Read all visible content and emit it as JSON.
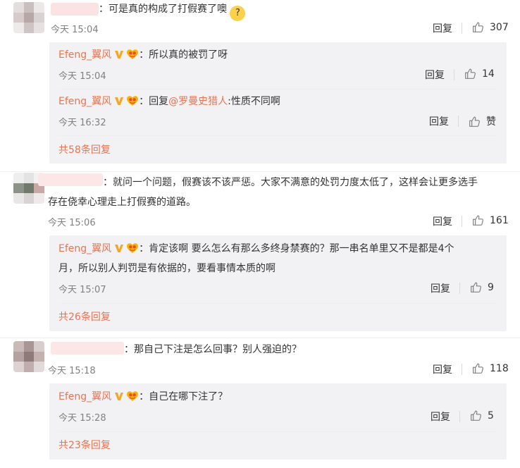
{
  "comments": [
    {
      "text": "：可是真的构成了打假赛了噢",
      "emoji": "🤔",
      "time": "今天 15:04",
      "reply_label": "回复",
      "likes": "307",
      "sub": [
        {
          "user": "Efeng_翼风",
          "text": "：所以真的被罚了呀",
          "time": "今天 15:04",
          "reply_label": "回复",
          "likes": "14"
        },
        {
          "user": "Efeng_翼风",
          "text_prefix": "：回复",
          "mention": "@罗曼史猎人",
          "text_suffix": ":性质不同啊",
          "time": "今天 16:32",
          "reply_label": "回复",
          "likes": "赞"
        }
      ],
      "more": "共58条回复"
    },
    {
      "text_line1": "：就问一个问题，假赛该不该严惩。大家不满意的处罚力度太低了，这样会让更多选手",
      "text_line2": "存在侥幸心理走上打假赛的道路。",
      "time": "今天 15:06",
      "reply_label": "回复",
      "likes": "161",
      "sub": [
        {
          "user": "Efeng_翼风",
          "text_line1": "：肯定该啊 要么怎么有那么多终身禁赛的？那一串名单里又不是都是4个",
          "text_line2": "月，所以别人判罚是有依据的，要看事情本质的啊",
          "time": "今天 15:07",
          "reply_label": "回复",
          "likes": "9"
        }
      ],
      "more": "共26条回复"
    },
    {
      "text": "：那自己下注是怎么回事？别人强迫的？",
      "time": "今天 15:18",
      "reply_label": "回复",
      "likes": "118",
      "sub": [
        {
          "user": "Efeng_翼风",
          "text": "：自己在哪下注了？",
          "time": "今天 15:28",
          "reply_label": "回复",
          "likes": "5"
        }
      ],
      "more": "共23条回复"
    }
  ]
}
